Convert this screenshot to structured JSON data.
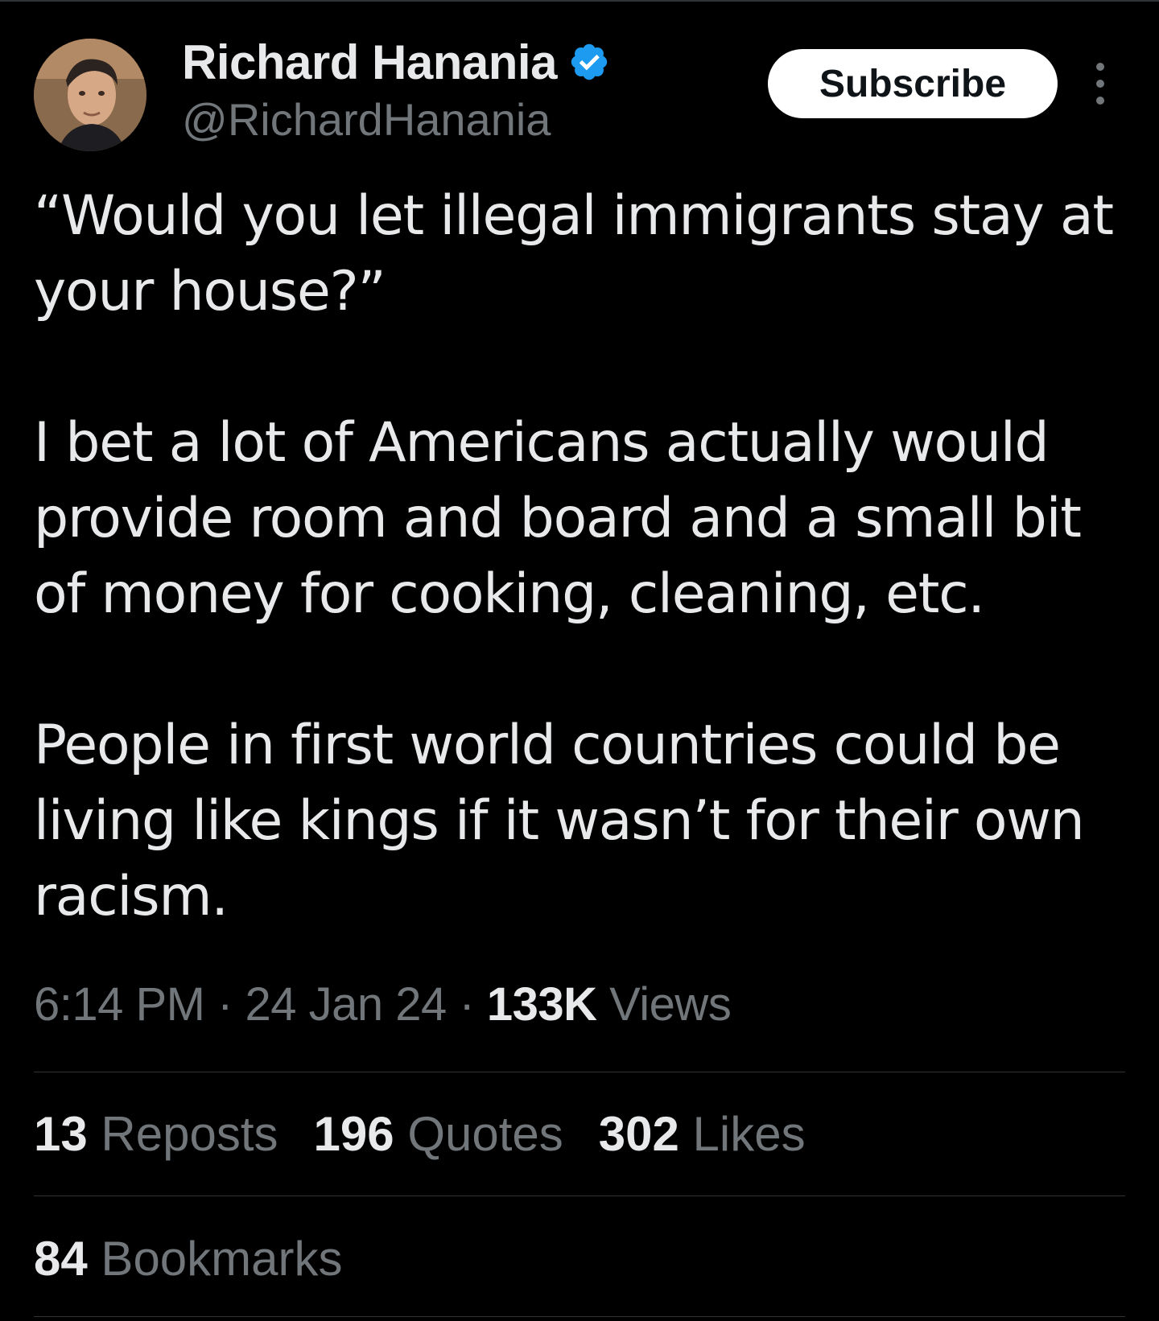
{
  "author": {
    "display_name": "Richard Hanania",
    "handle": "@RichardHanania",
    "verified_color": "#1d9bf0"
  },
  "header": {
    "subscribe_label": "Subscribe",
    "more_icon": "more-vertical-icon"
  },
  "tweet": {
    "paragraphs": [
      "“Would you let illegal immigrants stay at your house?”",
      "I bet a lot of Americans actually would provide room and board and a small bit of money for cooking, cleaning, etc.",
      "People in first world countries could be living like kings if it wasn’t for their own racism."
    ]
  },
  "meta": {
    "time": "6:14 PM",
    "separator": " · ",
    "date": "24 Jan 24",
    "views_count": "133K",
    "views_label": "Views"
  },
  "stats": {
    "reposts_count": "13",
    "reposts_label": "Reposts",
    "quotes_count": "196",
    "quotes_label": "Quotes",
    "likes_count": "302",
    "likes_label": "Likes",
    "bookmarks_count": "84",
    "bookmarks_label": "Bookmarks"
  },
  "colors": {
    "background": "#000000",
    "text_primary": "#e7e9ea",
    "text_secondary": "#71767b",
    "divider": "#2f3336"
  }
}
